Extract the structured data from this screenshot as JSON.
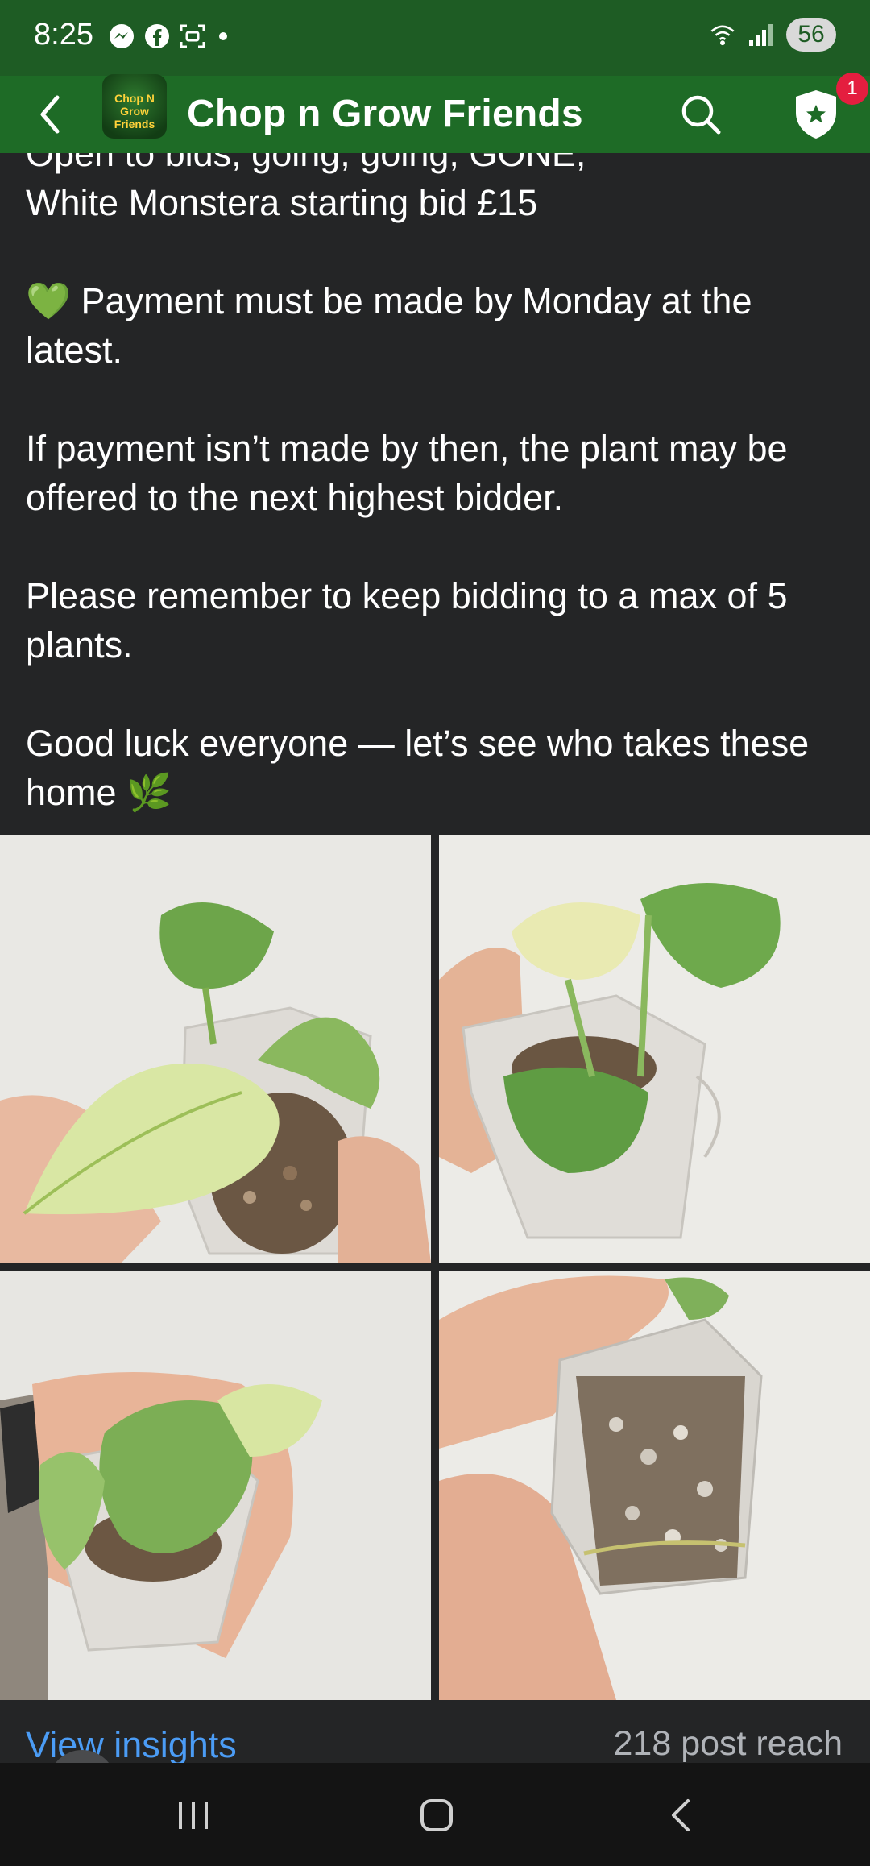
{
  "status_bar": {
    "time": "8:25",
    "battery": "56",
    "icons": [
      "messenger-icon",
      "facebook-icon",
      "screen-capture-icon",
      "wifi-icon",
      "signal-icon"
    ]
  },
  "app_bar": {
    "group_name": "Chop n Grow Friends",
    "avatar_title": "Chop N Grow Friends",
    "badge_count": "1"
  },
  "post": {
    "line1": "Open to bids, going, going, GONE,",
    "line2": "White Monstera starting bid £15",
    "payment_emoji": "💚",
    "payment": "Payment must be made by Monday at the latest.",
    "not_made": "If payment isn’t made by then, the plant may be offered to the next highest bidder.",
    "max_bid": "Please remember to keep bidding to a max of 5 plants.",
    "good_luck": "Good luck everyone — let’s see who takes these home",
    "herb_emoji": "🌿"
  },
  "footer": {
    "view_insights": "View insights",
    "post_reach": "218 post reach"
  },
  "colors": {
    "header_green": "#1e6b26",
    "status_green": "#1e5c24",
    "background": "#242526",
    "link_blue": "#4b9cf5",
    "badge_red": "#e41e3f"
  }
}
